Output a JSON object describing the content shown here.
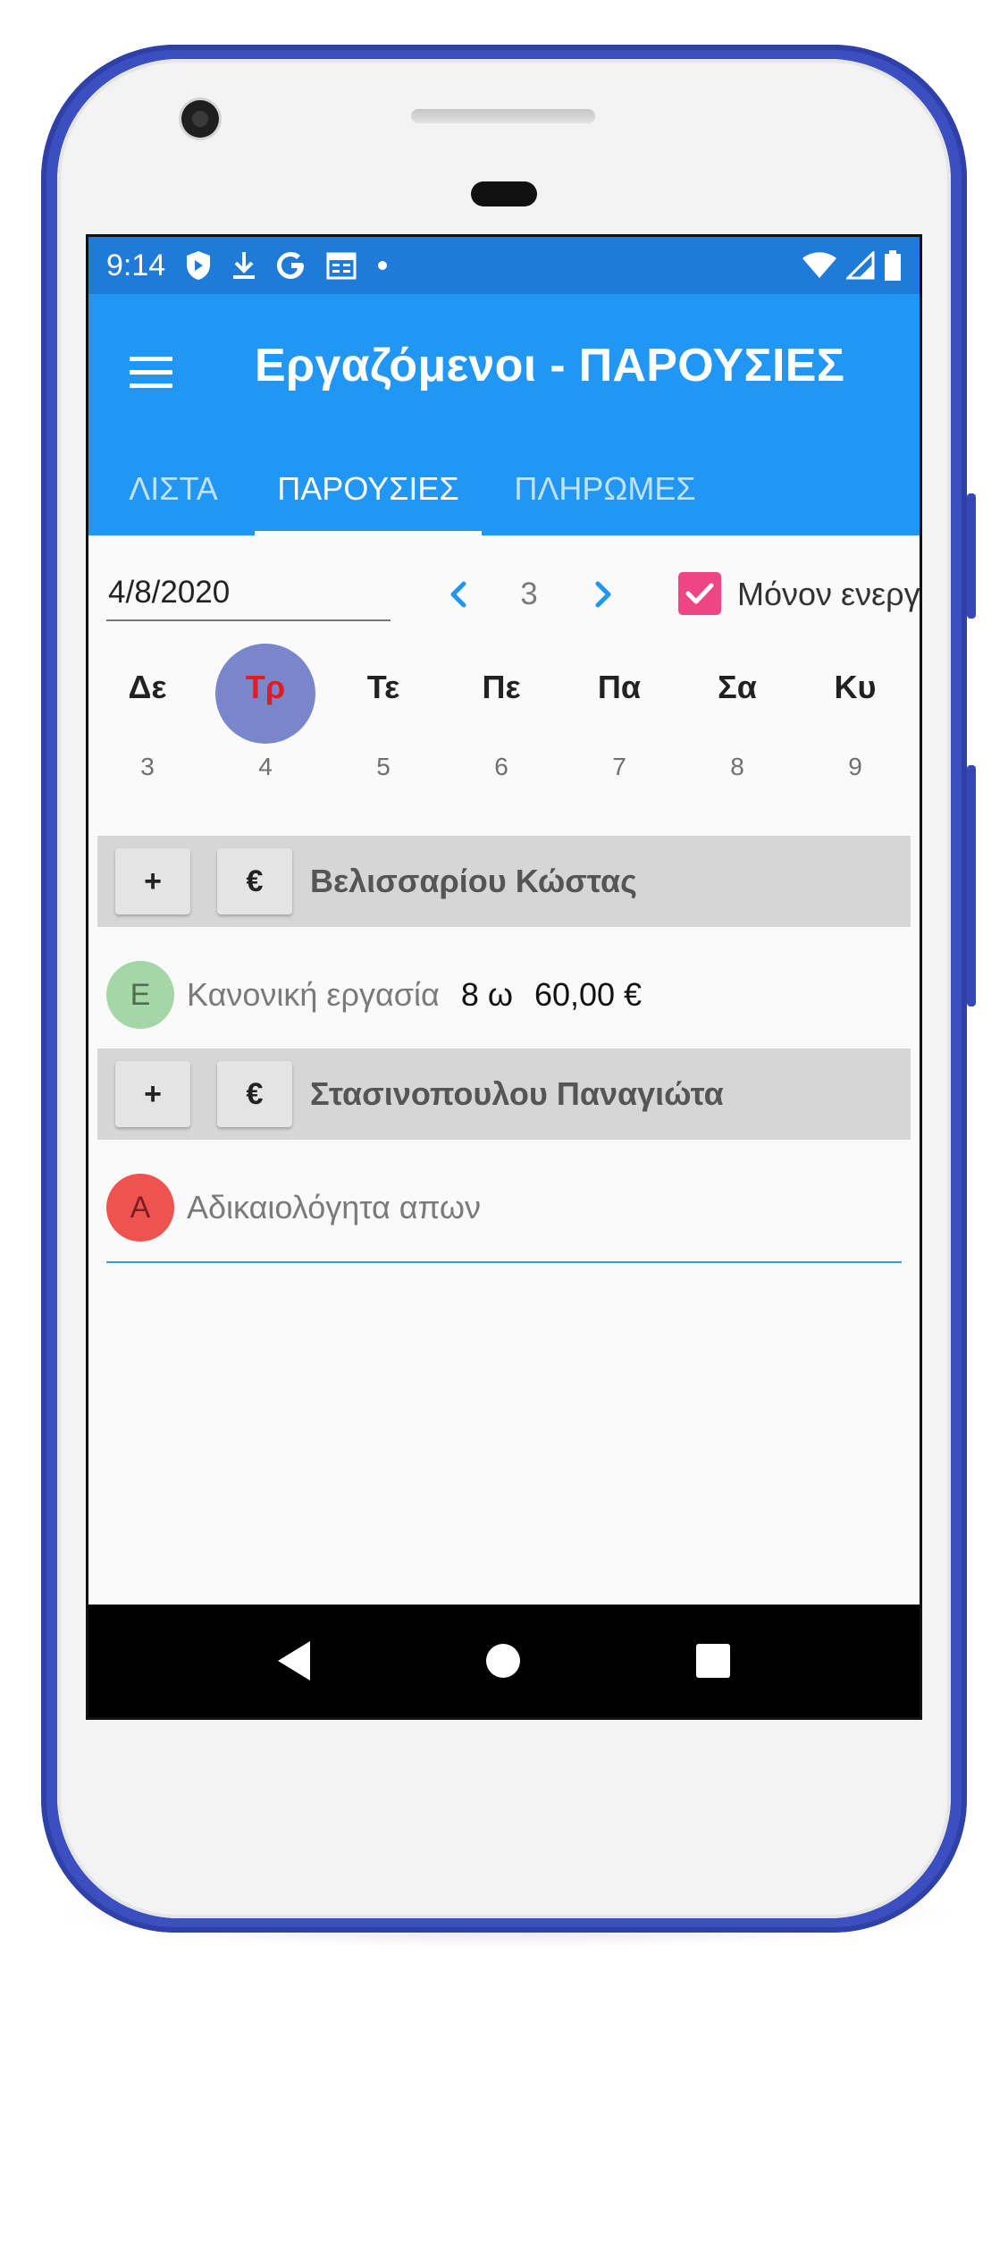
{
  "status_bar": {
    "time": "9:14",
    "icons_left": [
      "shield-icon",
      "download-icon",
      "google-icon",
      "calendar-icon",
      "dot-icon"
    ],
    "icons_right": [
      "wifi-icon",
      "signal-icon",
      "battery-icon"
    ]
  },
  "app_bar": {
    "title": "Εργαζόμενοι - ΠΑΡΟΥΣΙΕΣ",
    "menu_icon": "menu-icon"
  },
  "tabs": [
    {
      "label": "ΛΙΣΤΑ",
      "active": false
    },
    {
      "label": "ΠΑΡΟΥΣΙΕΣ",
      "active": true
    },
    {
      "label": "ΠΛΗΡΩΜΕΣ",
      "active": false
    }
  ],
  "controls": {
    "date_value": "4/8/2020",
    "week_number": "3",
    "prev_icon": "chevron-left-icon",
    "next_icon": "chevron-right-icon",
    "only_active_checked": true,
    "only_active_label": "Μόνον ενεργοί"
  },
  "days": [
    {
      "name": "Δε",
      "num": "3",
      "selected": false
    },
    {
      "name": "Τρ",
      "num": "4",
      "selected": true
    },
    {
      "name": "Τε",
      "num": "5",
      "selected": false
    },
    {
      "name": "Πε",
      "num": "6",
      "selected": false
    },
    {
      "name": "Πα",
      "num": "7",
      "selected": false
    },
    {
      "name": "Σα",
      "num": "8",
      "selected": false
    },
    {
      "name": "Κυ",
      "num": "9",
      "selected": false
    }
  ],
  "employees": [
    {
      "add_label": "+",
      "pay_label": "€",
      "name": "Βελισσαρίου Κώστας",
      "entries": [
        {
          "avatar_letter": "Ε",
          "avatar_color": "#a5d6a7",
          "avatar_text_color": "#4e6e50",
          "description": "Κανονική εργασία",
          "hours": "8 ω",
          "amount": "60,00 €"
        }
      ]
    },
    {
      "add_label": "+",
      "pay_label": "€",
      "name": "Στασινοπουλου Παναγιώτα",
      "entries": [
        {
          "avatar_letter": "Α",
          "avatar_color": "#ef5350",
          "avatar_text_color": "#7a1f1f",
          "description": "Αδικαιολόγητα απων",
          "hours": "",
          "amount": ""
        }
      ]
    }
  ],
  "colors": {
    "status_bar": "#1f7ad8",
    "app_bar": "#2196f3",
    "accent_checkbox": "#ef4584",
    "selected_day": "#7986cb",
    "selected_day_text": "#e31b1b",
    "phone_frame": "#3b4fc0"
  },
  "system_nav": {
    "back_icon": "back-triangle-icon",
    "home_icon": "home-circle-icon",
    "recents_icon": "recents-square-icon"
  }
}
